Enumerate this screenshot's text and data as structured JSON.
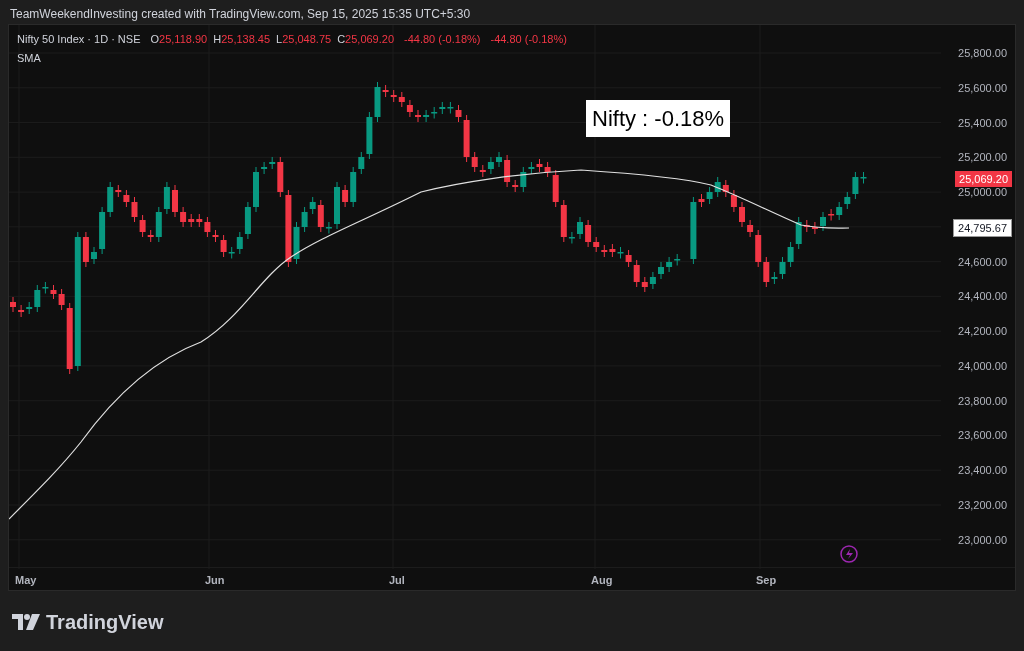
{
  "header": "TeamWeekendInvesting created with TradingView.com, Sep 15, 2025 15:35 UTC+5:30",
  "legend": {
    "symbol": "Nifty 50 Index · 1D · NSE",
    "falling": true,
    "ohlc": [
      {
        "label": "O",
        "value": "25,118.90"
      },
      {
        "label": "H",
        "value": "25,138.45"
      },
      {
        "label": "L",
        "value": "25,048.75"
      },
      {
        "label": "C",
        "value": "25,069.20"
      }
    ],
    "changes": [
      "-44.80 (-0.18%)",
      "-44.80 (-0.18%)"
    ],
    "indicator": "SMA"
  },
  "annotation": "Nifty : -0.18%",
  "price_axis": [
    "25,800.00",
    "25,600.00",
    "25,400.00",
    "25,200.00",
    "25,000.00",
    "24,600.00",
    "24,400.00",
    "24,200.00",
    "24,000.00",
    "23,800.00",
    "23,600.00",
    "23,400.00",
    "23,200.00",
    "23,000.00"
  ],
  "price_labels": [
    {
      "kind": "last",
      "text": "25,069.20"
    },
    {
      "kind": "sma",
      "text": "24,795.67"
    }
  ],
  "time_axis": [
    "May",
    "Jun",
    "Jul",
    "Aug",
    "Sep"
  ],
  "footer_logo": "TradingView"
}
